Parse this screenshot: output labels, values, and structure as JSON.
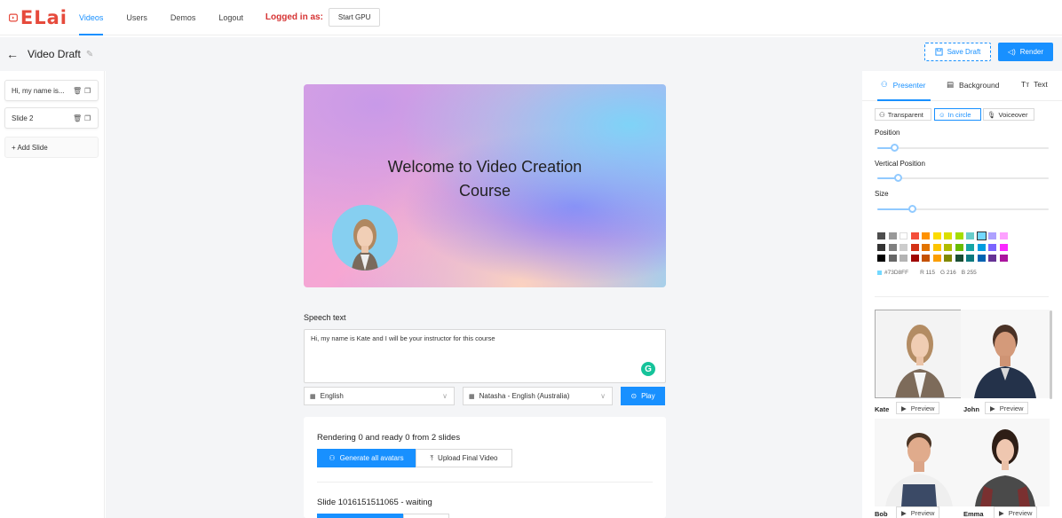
{
  "nav": {
    "logo_text": "ELai",
    "items": [
      "Videos",
      "Users",
      "Demos",
      "Logout"
    ],
    "active": "Videos",
    "logged_in_label": "Logged in as:",
    "start_gpu": "Start GPU"
  },
  "header": {
    "title": "Video Draft",
    "save_draft": "Save Draft",
    "render": "Render"
  },
  "slides": {
    "items": [
      {
        "label": "Hi, my name is..."
      },
      {
        "label": "Slide 2"
      }
    ],
    "add_slide": "+ Add Slide"
  },
  "canvas": {
    "title_line1": "Welcome to Video Creation",
    "title_line2": "Course"
  },
  "speech": {
    "label": "Speech text",
    "text": "Hi, my name is Kate and I will be your instructor for this course",
    "language": "English",
    "voice": "Natasha - English (Australia)",
    "play": "Play"
  },
  "rendering": {
    "status": "Rendering 0 and ready 0 from 2 slides",
    "generate": "Generate all avatars",
    "upload": "Upload Final Video",
    "slide_status": "Slide 1016151511065 - waiting"
  },
  "right": {
    "tabs": [
      "Presenter",
      "Background",
      "Text"
    ],
    "active_tab": "Presenter",
    "modes": [
      "Transparent",
      "In circle",
      "Voiceover"
    ],
    "active_mode": "In circle",
    "position_label": "Position",
    "vertical_label": "Vertical Position",
    "size_label": "Size",
    "position_value": 0.1,
    "vertical_value": 0.12,
    "size_value": 0.2,
    "hex": "#73D8FF",
    "r": "R 115",
    "g": "G 216",
    "b": "B 255",
    "presenters": [
      {
        "name": "Kate",
        "preview": "Preview"
      },
      {
        "name": "John",
        "preview": "Preview"
      },
      {
        "name": "Bob",
        "preview": "Preview"
      },
      {
        "name": "Emma",
        "preview": "Preview"
      }
    ]
  },
  "colors": {
    "accent": "#1890ff",
    "brand": "#e64a3c",
    "palette": [
      [
        "#4d4d4d",
        "#999999",
        "#ffffff",
        "#f44e3b",
        "#fe9200",
        "#fcdc00",
        "#dbdf00",
        "#a4dd00",
        "#68ccca",
        "#73d8ff",
        "#aea1ff",
        "#fda1ff"
      ],
      [
        "#333333",
        "#808080",
        "#cccccc",
        "#d33115",
        "#e27300",
        "#fcc400",
        "#b0bc00",
        "#68bc00",
        "#16a5a5",
        "#009ce0",
        "#7b64ff",
        "#fa28ff"
      ],
      [
        "#000000",
        "#666666",
        "#b3b3b3",
        "#9f0500",
        "#c45100",
        "#fb9e00",
        "#808900",
        "#194d33",
        "#0c797d",
        "#0062b1",
        "#653294",
        "#ab149e"
      ]
    ]
  }
}
